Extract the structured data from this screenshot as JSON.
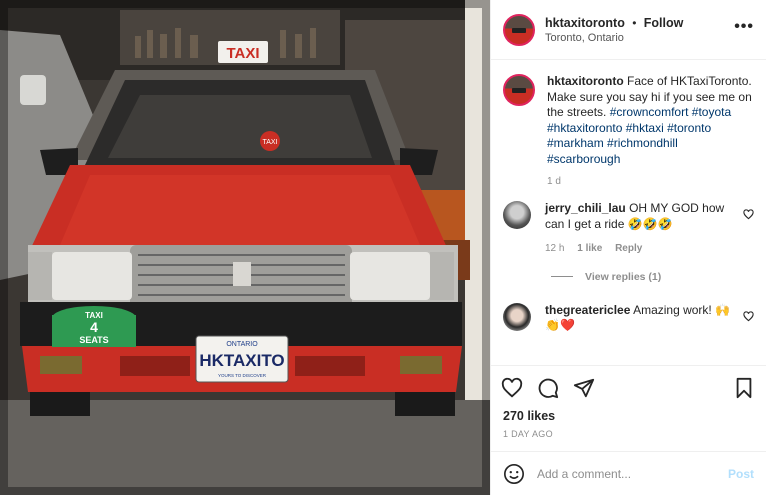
{
  "post": {
    "username": "hktaxitoronto",
    "follow_label": "Follow",
    "location": "Toronto, Ontario",
    "more_label": "•••"
  },
  "photo": {
    "roof_sign": "TAXI",
    "dash_sign": "TAXI",
    "plate_province": "ONTARIO",
    "plate_text": "HKTAXITO",
    "plate_slogan": "YOURS TO DISCOVER",
    "seats_top": "TAXI",
    "seats_number": "4",
    "seats_bottom": "SEATS"
  },
  "caption": {
    "username": "hktaxitoronto",
    "text": "Face of HKTaxiToronto. Make sure you say hi if you see me on the streets.",
    "hashtags": [
      "#crowncomfort",
      "#toyota",
      "#hktaxitoronto",
      "#hktaxi",
      "#toronto",
      "#markham",
      "#richmondhill",
      "#scarborough"
    ],
    "age": "1 d"
  },
  "comments": [
    {
      "username": "jerry_chili_lau",
      "text": "OH MY GOD how can I get a ride 🤣🤣🤣",
      "age": "12 h",
      "likes": "1 like",
      "reply_label": "Reply",
      "view_replies": "View replies (1)"
    },
    {
      "username": "thegreatericlee",
      "text": "Amazing work! 🙌👏❤️"
    }
  ],
  "footer": {
    "likes": "270 likes",
    "date": "1 DAY AGO",
    "add_comment_placeholder": "Add a comment...",
    "post_label": "Post"
  },
  "icons": [
    "heart-icon",
    "comment-icon",
    "share-icon",
    "bookmark-icon",
    "emoji-icon"
  ],
  "colors": {
    "link": "#00376b",
    "post_disabled": "#b2dffc",
    "taxi_red": "#c92e24",
    "muted": "#8e8e8e"
  }
}
